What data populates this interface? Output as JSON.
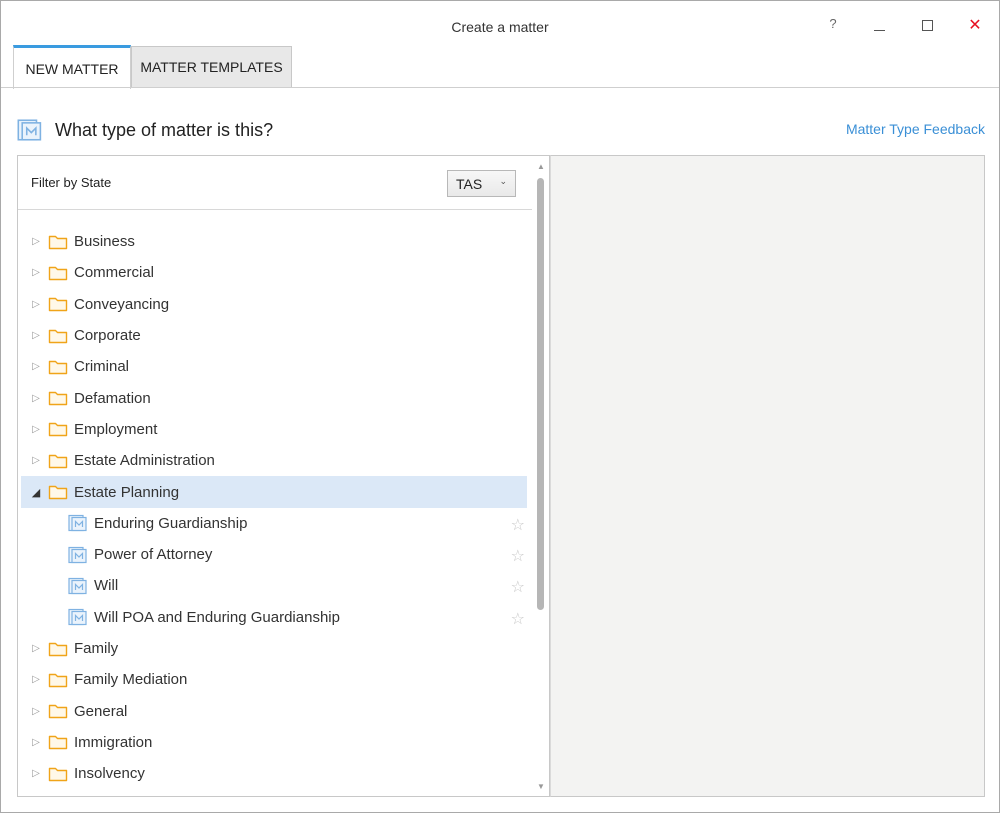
{
  "window": {
    "title": "Create a matter",
    "help": "?",
    "close": "✕"
  },
  "tabs": [
    {
      "label": "NEW MATTER"
    },
    {
      "label": "MATTER TEMPLATES"
    }
  ],
  "heading": {
    "text": "What type of matter is this?",
    "feedback_link": "Matter Type Feedback"
  },
  "filter": {
    "label": "Filter by State",
    "selected_state": "TAS"
  },
  "tree": {
    "categories": [
      {
        "label": "Business"
      },
      {
        "label": "Commercial"
      },
      {
        "label": "Conveyancing"
      },
      {
        "label": "Corporate"
      },
      {
        "label": "Criminal"
      },
      {
        "label": "Defamation"
      },
      {
        "label": "Employment"
      },
      {
        "label": "Estate Administration"
      },
      {
        "label": "Estate Planning",
        "expanded": true
      },
      {
        "label": "Family"
      },
      {
        "label": "Family Mediation"
      },
      {
        "label": "General"
      },
      {
        "label": "Immigration"
      },
      {
        "label": "Insolvency"
      }
    ],
    "estate_planning_children": [
      {
        "label": "Enduring Guardianship"
      },
      {
        "label": "Power of Attorney"
      },
      {
        "label": "Will"
      },
      {
        "label": "Will POA and Enduring Guardianship"
      }
    ]
  },
  "colors": {
    "accent": "#3a9be0",
    "folder": "#f0a419",
    "link": "#3a8fd6",
    "selected_row": "#dbe8f7",
    "close": "#e81123"
  },
  "icons": {
    "folder": "folder-icon",
    "matter": "matter-type-icon",
    "favorite": "star-icon",
    "expand": "triangle-right-icon",
    "collapse": "triangle-down-icon"
  }
}
